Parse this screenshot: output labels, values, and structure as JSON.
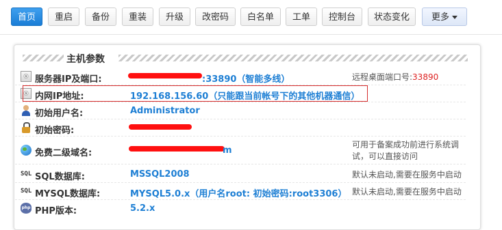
{
  "toolbar": {
    "buttons": [
      "首页",
      "重启",
      "备份",
      "重装",
      "升级",
      "改密码",
      "白名单",
      "工单",
      "控制台",
      "状态变化"
    ],
    "more_label": "更多"
  },
  "panel": {
    "title": "主机参数",
    "rows": [
      {
        "label": "服务器IP及端口:",
        "value": ":33890（智能多线）",
        "note": "远程桌面端口号:",
        "note_value": "33890",
        "icon": "server-icon"
      },
      {
        "label": "内网IP地址:",
        "value": "192.168.156.60（只能跟当前帐号下的其他机器通信）",
        "note": "",
        "icon": "server-icon"
      },
      {
        "label": "初始用户名:",
        "value": "Administrator",
        "note": "",
        "icon": "user-icon"
      },
      {
        "label": "初始密码:",
        "value": "",
        "note": "",
        "icon": "lock-icon"
      },
      {
        "label": "免费二级域名:",
        "value": "m",
        "note": "可用于备案成功前进行系统调试，可以直接访问",
        "icon": "globe-icon"
      },
      {
        "label": "SQL数据库:",
        "value": "MSSQL2008",
        "note": "默认未启动,需要在服务中启动",
        "icon": "sql-icon"
      },
      {
        "label": "MYSQL数据库:",
        "value": "MYSQL5.0.x（用户名root:  初始密码:root3306）",
        "note": "默认未启动,需要在服务中启动",
        "icon": "sql-icon"
      },
      {
        "label": "PHP版本:",
        "value": "5.2.x",
        "note": "",
        "icon": "php-icon"
      }
    ]
  },
  "colors": {
    "accent": "#1e7fd4",
    "primary_button": "#2389e0",
    "highlight_border": "#d52b2b",
    "redaction": "#ff1010",
    "note_red": "#dd2222"
  }
}
